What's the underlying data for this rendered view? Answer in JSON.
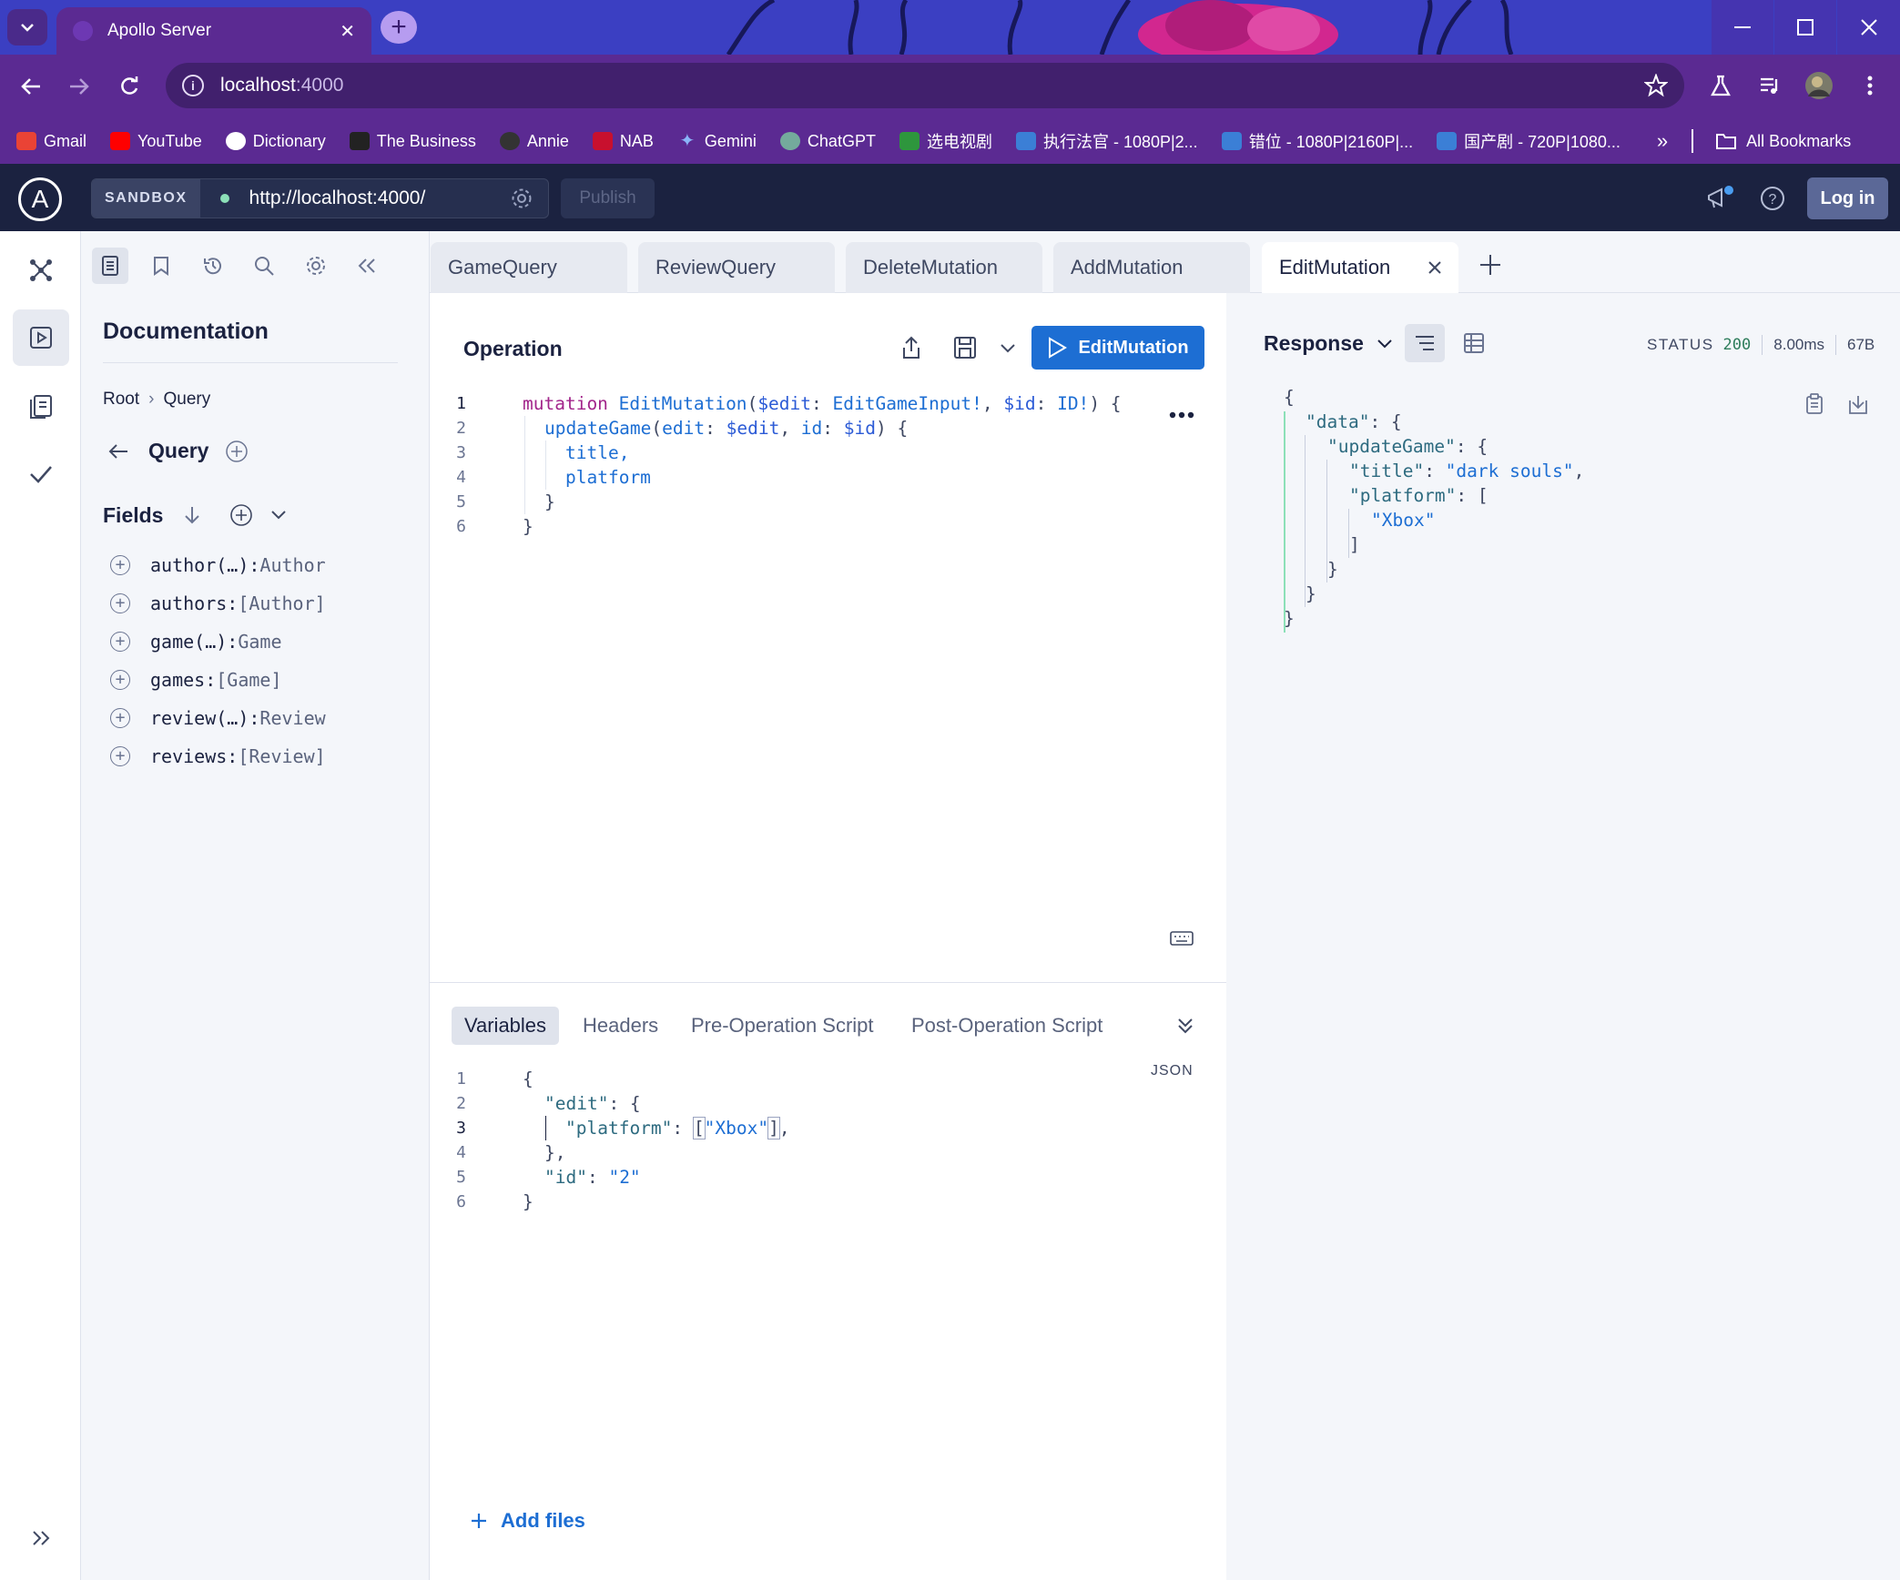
{
  "browser": {
    "tab_title": "Apollo Server",
    "url_host": "localhost",
    "url_port": ":4000",
    "bookmarks": [
      {
        "label": "Gmail",
        "color": "#ea4335"
      },
      {
        "label": "YouTube",
        "color": "#ff0000"
      },
      {
        "label": "Dictionary",
        "color": "#ffffff"
      },
      {
        "label": "The Business",
        "color": "#222222"
      },
      {
        "label": "Annie",
        "color": "#333333"
      },
      {
        "label": "NAB",
        "color": "#c8102e"
      },
      {
        "label": "Gemini",
        "color": "#8ab4f8"
      },
      {
        "label": "ChatGPT",
        "color": "#74aa9c"
      },
      {
        "label": "选电视剧",
        "color": "#2e963d"
      },
      {
        "label": "执行法官 - 1080P|2...",
        "color": "#3b7fd6"
      },
      {
        "label": "错位 - 1080P|2160P|...",
        "color": "#3b7fd6"
      },
      {
        "label": "国产剧 - 720P|1080...",
        "color": "#3b7fd6"
      }
    ],
    "overflow": "»",
    "all_bookmarks": "All Bookmarks"
  },
  "header": {
    "sandbox": "SANDBOX",
    "endpoint": "http://localhost:4000/",
    "publish": "Publish",
    "login": "Log in"
  },
  "docs": {
    "title": "Documentation",
    "breadcrumb_root": "Root",
    "breadcrumb_sep": "›",
    "breadcrumb_current": "Query",
    "type_name": "Query",
    "fields_label": "Fields",
    "fields": [
      {
        "name": "author(…)",
        "sep": ": ",
        "type": "Author"
      },
      {
        "name": "authors",
        "sep": ": ",
        "type": "[Author]"
      },
      {
        "name": "game(…)",
        "sep": ": ",
        "type": "Game"
      },
      {
        "name": "games",
        "sep": ": ",
        "type": "[Game]"
      },
      {
        "name": "review(…)",
        "sep": ": ",
        "type": "Review"
      },
      {
        "name": "reviews",
        "sep": ": ",
        "type": "[Review]"
      }
    ]
  },
  "tabs": [
    "GameQuery",
    "ReviewQuery",
    "DeleteMutation",
    "AddMutation",
    "EditMutation"
  ],
  "operation": {
    "label": "Operation",
    "run_label": "EditMutation",
    "line_numbers": [
      "1",
      "2",
      "3",
      "4",
      "5",
      "6"
    ],
    "code": {
      "l1_kw": "mutation",
      "l1_name": "EditMutation",
      "l1_open": "(",
      "l1_var1": "$edit",
      "l1_c1": ": ",
      "l1_type1": "EditGameInput!",
      "l1_comma": ", ",
      "l1_var2": "$id",
      "l1_c2": ": ",
      "l1_type2": "ID!",
      "l1_close": ") {",
      "l2_field": "updateGame",
      "l2_open": "(",
      "l2_arg1": "edit",
      "l2_c1": ": ",
      "l2_var1": "$edit",
      "l2_comma": ", ",
      "l2_arg2": "id",
      "l2_c2": ": ",
      "l2_var2": "$id",
      "l2_close": ") {",
      "l3": "title,",
      "l4": "platform",
      "l5": "}",
      "l6": "}"
    }
  },
  "variables": {
    "tabs": [
      "Variables",
      "Headers",
      "Pre-Operation Script",
      "Post-Operation Script"
    ],
    "format": "JSON",
    "line_numbers": [
      "1",
      "2",
      "3",
      "4",
      "5",
      "6"
    ],
    "lines": {
      "l1": "{",
      "l2_key": "\"edit\"",
      "l2_rest": ": {",
      "l3_key": "\"platform\"",
      "l3_colon": ": ",
      "l3_open": "[",
      "l3_val": "\"Xbox\"",
      "l3_close": "]",
      "l3_comma": ",",
      "l4": "},",
      "l5_key": "\"id\"",
      "l5_colon": ": ",
      "l5_val": "\"2\"",
      "l6": "}"
    },
    "add_files": "Add files"
  },
  "response": {
    "title": "Response",
    "status_label": "STATUS",
    "status_code": "200",
    "time": "8.00ms",
    "size": "67B",
    "lines": {
      "l1": "{",
      "l2_key": "\"data\"",
      "l2_rest": ": {",
      "l3_key": "\"updateGame\"",
      "l3_rest": ": {",
      "l4_key": "\"title\"",
      "l4_colon": ": ",
      "l4_val": "\"dark souls\"",
      "l4_comma": ",",
      "l5_key": "\"platform\"",
      "l5_rest": ": [",
      "l6_val": "\"Xbox\"",
      "l7": "]",
      "l8": "}",
      "l9": "}",
      "l10": "}"
    }
  }
}
